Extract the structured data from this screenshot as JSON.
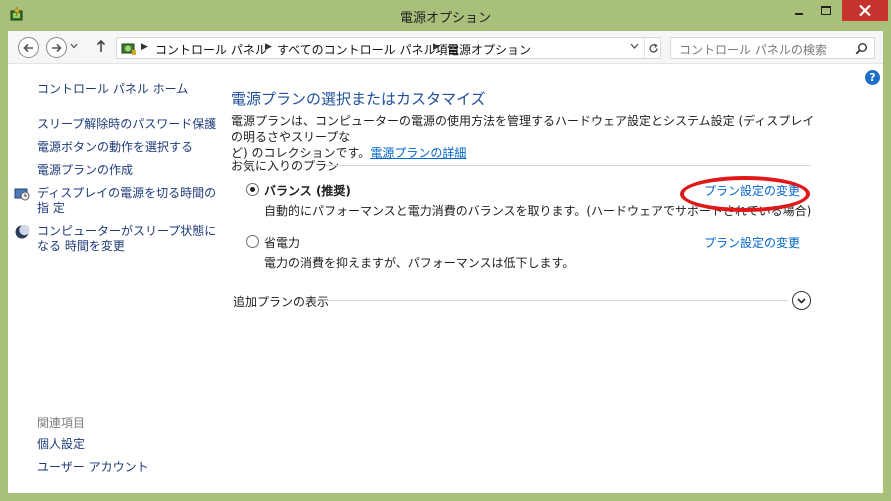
{
  "window": {
    "title": "電源オプション"
  },
  "address": {
    "crumbs": [
      "コントロール パネル",
      "すべてのコントロール パネル項目",
      "電源オプション"
    ],
    "search_placeholder": "コントロール パネルの検索"
  },
  "sidebar": {
    "home": "コントロール パネル ホーム",
    "items": [
      {
        "label": "スリープ解除時のパスワード保護"
      },
      {
        "label": "電源ボタンの動作を選択する"
      },
      {
        "label": "電源プランの作成"
      },
      {
        "label_line1": "ディスプレイの電源を切る時間の指",
        "label_line2": "定"
      },
      {
        "label_line1": "コンピューターがスリープ状態になる",
        "label_line2": "時間を変更"
      }
    ],
    "related_title": "関連項目",
    "related": [
      "個人設定",
      "ユーザー アカウント"
    ]
  },
  "main": {
    "title": "電源プランの選択またはカスタマイズ",
    "description_line1": "電源プランは、コンピューターの電源の使用方法を管理するハードウェア設定とシステム設定 (ディスプレイの明るさやスリープな",
    "description_line2": "ど) のコレクションです。",
    "details_link": "電源プランの詳細",
    "favorites_label": "お気に入りのプラン",
    "plans": [
      {
        "name": "バランス (推奨)",
        "selected": true,
        "description": "自動的にパフォーマンスと電力消費のバランスを取ります。(ハードウェアでサポートされている場合)",
        "change_link": "プラン設定の変更"
      },
      {
        "name": "省電力",
        "selected": false,
        "description": "電力の消費を抑えますが、パフォーマンスは低下します。",
        "change_link": "プラン設定の変更"
      }
    ],
    "more_plans": "追加プランの表示"
  },
  "colors": {
    "titlebar": "#a9c07b",
    "close_button": "#c7332d",
    "link": "#0066cc",
    "heading": "#1e4e9c",
    "annotation": "#e01818"
  }
}
